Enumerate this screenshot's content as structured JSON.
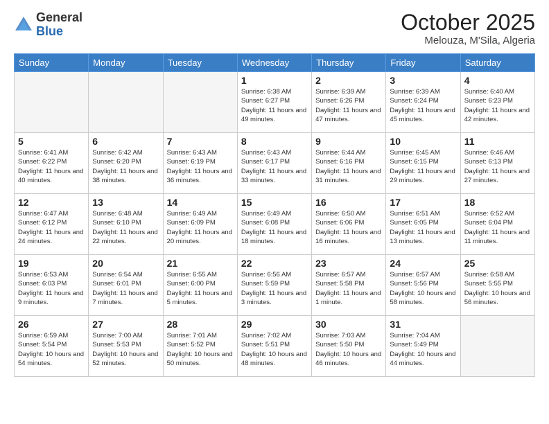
{
  "logo": {
    "general": "General",
    "blue": "Blue"
  },
  "header": {
    "month": "October 2025",
    "location": "Melouza, M'Sila, Algeria"
  },
  "weekdays": [
    "Sunday",
    "Monday",
    "Tuesday",
    "Wednesday",
    "Thursday",
    "Friday",
    "Saturday"
  ],
  "weeks": [
    [
      {
        "day": "",
        "empty": true
      },
      {
        "day": "",
        "empty": true
      },
      {
        "day": "",
        "empty": true
      },
      {
        "day": "1",
        "sunrise": "Sunrise: 6:38 AM",
        "sunset": "Sunset: 6:27 PM",
        "daylight": "Daylight: 11 hours and 49 minutes."
      },
      {
        "day": "2",
        "sunrise": "Sunrise: 6:39 AM",
        "sunset": "Sunset: 6:26 PM",
        "daylight": "Daylight: 11 hours and 47 minutes."
      },
      {
        "day": "3",
        "sunrise": "Sunrise: 6:39 AM",
        "sunset": "Sunset: 6:24 PM",
        "daylight": "Daylight: 11 hours and 45 minutes."
      },
      {
        "day": "4",
        "sunrise": "Sunrise: 6:40 AM",
        "sunset": "Sunset: 6:23 PM",
        "daylight": "Daylight: 11 hours and 42 minutes."
      }
    ],
    [
      {
        "day": "5",
        "sunrise": "Sunrise: 6:41 AM",
        "sunset": "Sunset: 6:22 PM",
        "daylight": "Daylight: 11 hours and 40 minutes."
      },
      {
        "day": "6",
        "sunrise": "Sunrise: 6:42 AM",
        "sunset": "Sunset: 6:20 PM",
        "daylight": "Daylight: 11 hours and 38 minutes."
      },
      {
        "day": "7",
        "sunrise": "Sunrise: 6:43 AM",
        "sunset": "Sunset: 6:19 PM",
        "daylight": "Daylight: 11 hours and 36 minutes."
      },
      {
        "day": "8",
        "sunrise": "Sunrise: 6:43 AM",
        "sunset": "Sunset: 6:17 PM",
        "daylight": "Daylight: 11 hours and 33 minutes."
      },
      {
        "day": "9",
        "sunrise": "Sunrise: 6:44 AM",
        "sunset": "Sunset: 6:16 PM",
        "daylight": "Daylight: 11 hours and 31 minutes."
      },
      {
        "day": "10",
        "sunrise": "Sunrise: 6:45 AM",
        "sunset": "Sunset: 6:15 PM",
        "daylight": "Daylight: 11 hours and 29 minutes."
      },
      {
        "day": "11",
        "sunrise": "Sunrise: 6:46 AM",
        "sunset": "Sunset: 6:13 PM",
        "daylight": "Daylight: 11 hours and 27 minutes."
      }
    ],
    [
      {
        "day": "12",
        "sunrise": "Sunrise: 6:47 AM",
        "sunset": "Sunset: 6:12 PM",
        "daylight": "Daylight: 11 hours and 24 minutes."
      },
      {
        "day": "13",
        "sunrise": "Sunrise: 6:48 AM",
        "sunset": "Sunset: 6:10 PM",
        "daylight": "Daylight: 11 hours and 22 minutes."
      },
      {
        "day": "14",
        "sunrise": "Sunrise: 6:49 AM",
        "sunset": "Sunset: 6:09 PM",
        "daylight": "Daylight: 11 hours and 20 minutes."
      },
      {
        "day": "15",
        "sunrise": "Sunrise: 6:49 AM",
        "sunset": "Sunset: 6:08 PM",
        "daylight": "Daylight: 11 hours and 18 minutes."
      },
      {
        "day": "16",
        "sunrise": "Sunrise: 6:50 AM",
        "sunset": "Sunset: 6:06 PM",
        "daylight": "Daylight: 11 hours and 16 minutes."
      },
      {
        "day": "17",
        "sunrise": "Sunrise: 6:51 AM",
        "sunset": "Sunset: 6:05 PM",
        "daylight": "Daylight: 11 hours and 13 minutes."
      },
      {
        "day": "18",
        "sunrise": "Sunrise: 6:52 AM",
        "sunset": "Sunset: 6:04 PM",
        "daylight": "Daylight: 11 hours and 11 minutes."
      }
    ],
    [
      {
        "day": "19",
        "sunrise": "Sunrise: 6:53 AM",
        "sunset": "Sunset: 6:03 PM",
        "daylight": "Daylight: 11 hours and 9 minutes."
      },
      {
        "day": "20",
        "sunrise": "Sunrise: 6:54 AM",
        "sunset": "Sunset: 6:01 PM",
        "daylight": "Daylight: 11 hours and 7 minutes."
      },
      {
        "day": "21",
        "sunrise": "Sunrise: 6:55 AM",
        "sunset": "Sunset: 6:00 PM",
        "daylight": "Daylight: 11 hours and 5 minutes."
      },
      {
        "day": "22",
        "sunrise": "Sunrise: 6:56 AM",
        "sunset": "Sunset: 5:59 PM",
        "daylight": "Daylight: 11 hours and 3 minutes."
      },
      {
        "day": "23",
        "sunrise": "Sunrise: 6:57 AM",
        "sunset": "Sunset: 5:58 PM",
        "daylight": "Daylight: 11 hours and 1 minute."
      },
      {
        "day": "24",
        "sunrise": "Sunrise: 6:57 AM",
        "sunset": "Sunset: 5:56 PM",
        "daylight": "Daylight: 10 hours and 58 minutes."
      },
      {
        "day": "25",
        "sunrise": "Sunrise: 6:58 AM",
        "sunset": "Sunset: 5:55 PM",
        "daylight": "Daylight: 10 hours and 56 minutes."
      }
    ],
    [
      {
        "day": "26",
        "sunrise": "Sunrise: 6:59 AM",
        "sunset": "Sunset: 5:54 PM",
        "daylight": "Daylight: 10 hours and 54 minutes."
      },
      {
        "day": "27",
        "sunrise": "Sunrise: 7:00 AM",
        "sunset": "Sunset: 5:53 PM",
        "daylight": "Daylight: 10 hours and 52 minutes."
      },
      {
        "day": "28",
        "sunrise": "Sunrise: 7:01 AM",
        "sunset": "Sunset: 5:52 PM",
        "daylight": "Daylight: 10 hours and 50 minutes."
      },
      {
        "day": "29",
        "sunrise": "Sunrise: 7:02 AM",
        "sunset": "Sunset: 5:51 PM",
        "daylight": "Daylight: 10 hours and 48 minutes."
      },
      {
        "day": "30",
        "sunrise": "Sunrise: 7:03 AM",
        "sunset": "Sunset: 5:50 PM",
        "daylight": "Daylight: 10 hours and 46 minutes."
      },
      {
        "day": "31",
        "sunrise": "Sunrise: 7:04 AM",
        "sunset": "Sunset: 5:49 PM",
        "daylight": "Daylight: 10 hours and 44 minutes."
      },
      {
        "day": "",
        "empty": true
      }
    ]
  ]
}
